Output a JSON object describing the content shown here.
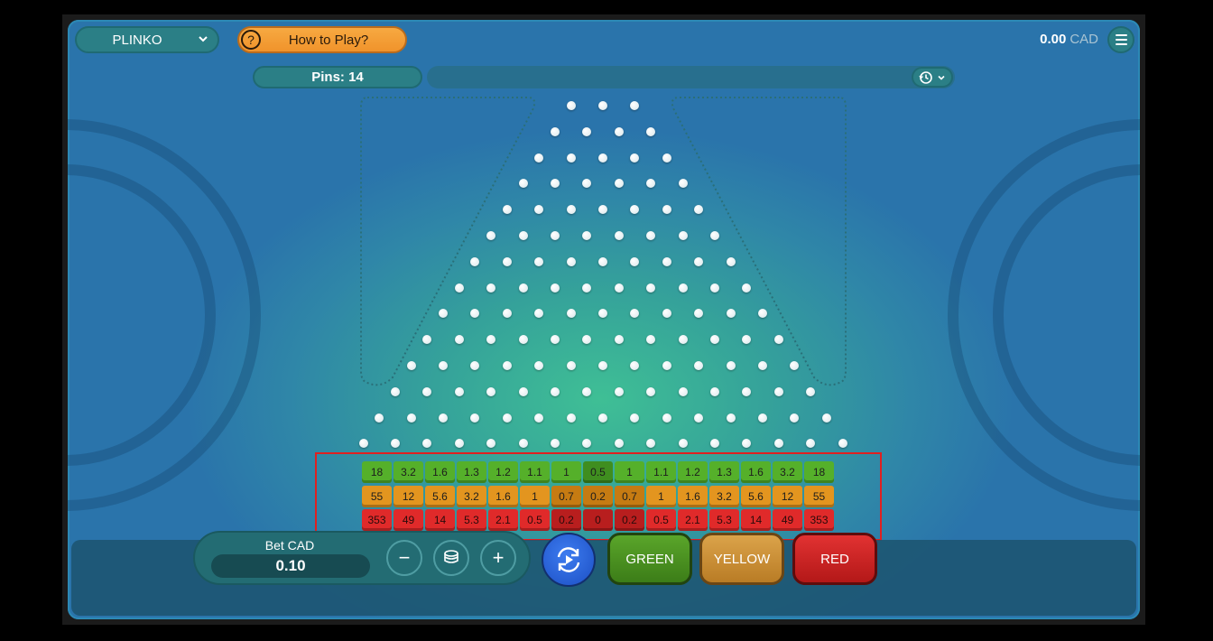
{
  "header": {
    "game_name": "PLINKO",
    "how_to_play": "How to Play?",
    "help_glyph": "?",
    "balance_amount": "0.00",
    "balance_currency": "CAD"
  },
  "board": {
    "pins_label": "Pins: 14",
    "history_icon": "history-icon"
  },
  "multipliers": {
    "green": [
      "18",
      "3.2",
      "1.6",
      "1.3",
      "1.2",
      "1.1",
      "1",
      "0.5",
      "1",
      "1.1",
      "1.2",
      "1.3",
      "1.6",
      "3.2",
      "18"
    ],
    "yellow": [
      "55",
      "12",
      "5.6",
      "3.2",
      "1.6",
      "1",
      "0.7",
      "0.2",
      "0.7",
      "1",
      "1.6",
      "3.2",
      "5.6",
      "12",
      "55"
    ],
    "red": [
      "353",
      "49",
      "14",
      "5.3",
      "2.1",
      "0.5",
      "0.2",
      "0",
      "0.2",
      "0.5",
      "2.1",
      "5.3",
      "14",
      "49",
      "353"
    ]
  },
  "controls": {
    "bet_label": "Bet CAD",
    "bet_value": "0.10",
    "minus_glyph": "−",
    "plus_glyph": "+",
    "green_label": "GREEN",
    "yellow_label": "YELLOW",
    "red_label": "RED"
  },
  "colors": {
    "green": "#55b02a",
    "yellow": "#e3951f",
    "red": "#e02a2a",
    "accent_blue": "#2f62e0"
  }
}
